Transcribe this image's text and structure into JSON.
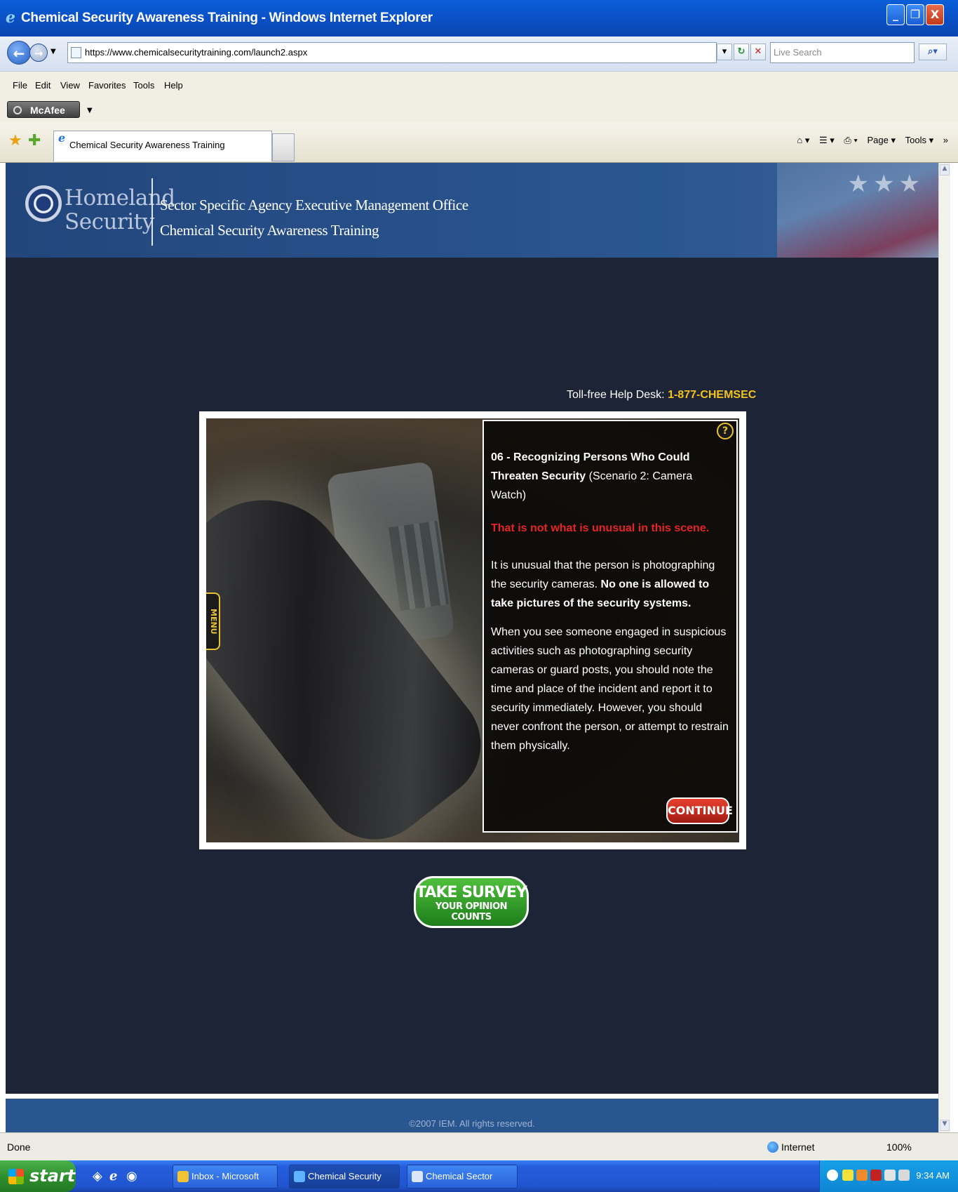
{
  "window": {
    "title": "Chemical Security Awareness Training - Windows Internet Explorer",
    "minimize": "_",
    "restore": "❐",
    "close": "X"
  },
  "addressbar": {
    "url": "https://www.chemicalsecuritytraining.com/launch2.aspx",
    "search_placeholder": "Live Search"
  },
  "menubar": {
    "items": [
      "File",
      "Edit",
      "View",
      "Favorites",
      "Tools",
      "Help"
    ]
  },
  "mcafee": {
    "label": "McAfee"
  },
  "tabs": {
    "active_label": "Chemical Security Awareness Training",
    "commands": [
      "Page ▾",
      "Tools ▾"
    ]
  },
  "banner": {
    "agency_line1": "Homeland",
    "agency_line2": "Security",
    "org_line1": "Sector Specific Agency Executive Management Office",
    "org_line2": "Chemical Security Awareness Training"
  },
  "helpdesk": {
    "label": "Toll-free Help Desk:",
    "number": "1-877-CHEMSEC"
  },
  "lesson": {
    "menu_tab": "MENU",
    "help_icon": "?",
    "heading": "06 - Recognizing Persons Who Could Threaten Security",
    "heading_sub": "(Scenario 2: Camera Watch)",
    "alert": "That is not what is unusual in this scene.",
    "para1_plain": "It is unusual that the person is photographing the security cameras.",
    "para1_bold": "No one is allowed to take pictures of the security systems.",
    "para2": "When you see someone engaged in suspicious activities such as photographing security cameras or guard posts, you should note the time and place of the incident and report it to security immediately. However, you should never confront the person, or attempt to restrain them physically.",
    "continue_label": "CONTINUE"
  },
  "survey": {
    "title": "TAKE SURVEY",
    "subtitle": "YOUR OPINION COUNTS"
  },
  "footer": {
    "copyright": "©2007 IEM. All rights reserved."
  },
  "statusbar": {
    "status": "Done",
    "zone": "Internet",
    "zoom": "100%"
  },
  "taskbar": {
    "start": "start",
    "tasks": [
      "Inbox - Microsoft Out...",
      "Chemical Security Aw...",
      "Chemical Sector Secu..."
    ],
    "time": "9:34 AM"
  },
  "colors": {
    "page_bg": "#1d2436",
    "banner_bg": "#2a5690",
    "accent_yellow": "#f3c21d",
    "alert_red": "#e62424",
    "continue_red": "#c0281a",
    "survey_green": "#2e9a28"
  }
}
